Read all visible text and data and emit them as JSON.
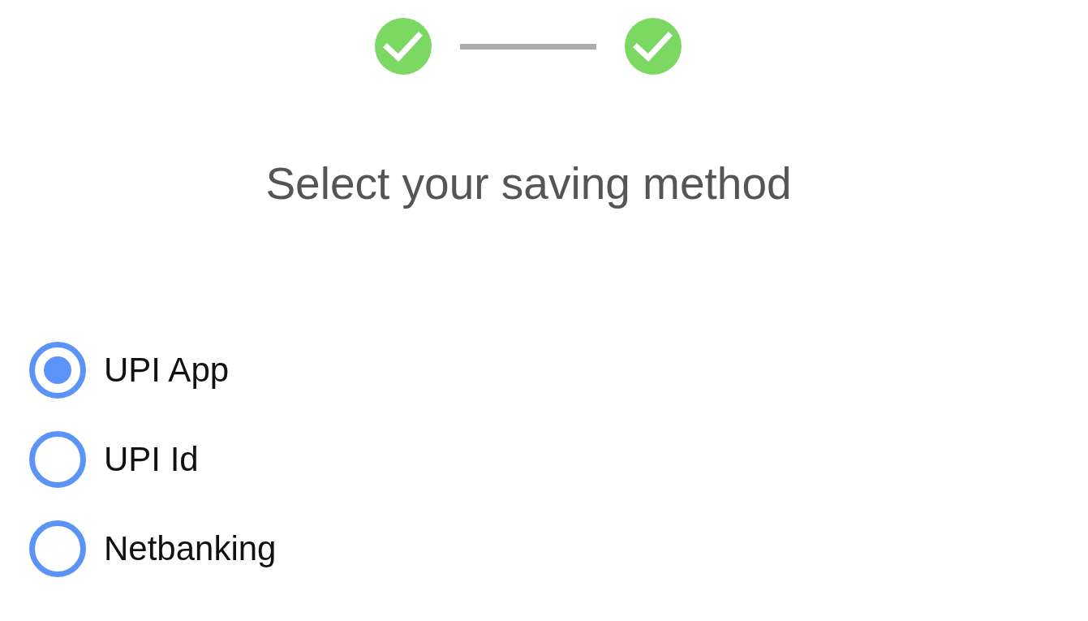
{
  "stepper": {
    "steps": [
      {
        "completed": true
      },
      {
        "completed": true
      }
    ]
  },
  "title": "Select your saving method",
  "options": [
    {
      "label": "UPI App",
      "selected": true
    },
    {
      "label": "UPI Id",
      "selected": false
    },
    {
      "label": "Netbanking",
      "selected": false
    }
  ]
}
